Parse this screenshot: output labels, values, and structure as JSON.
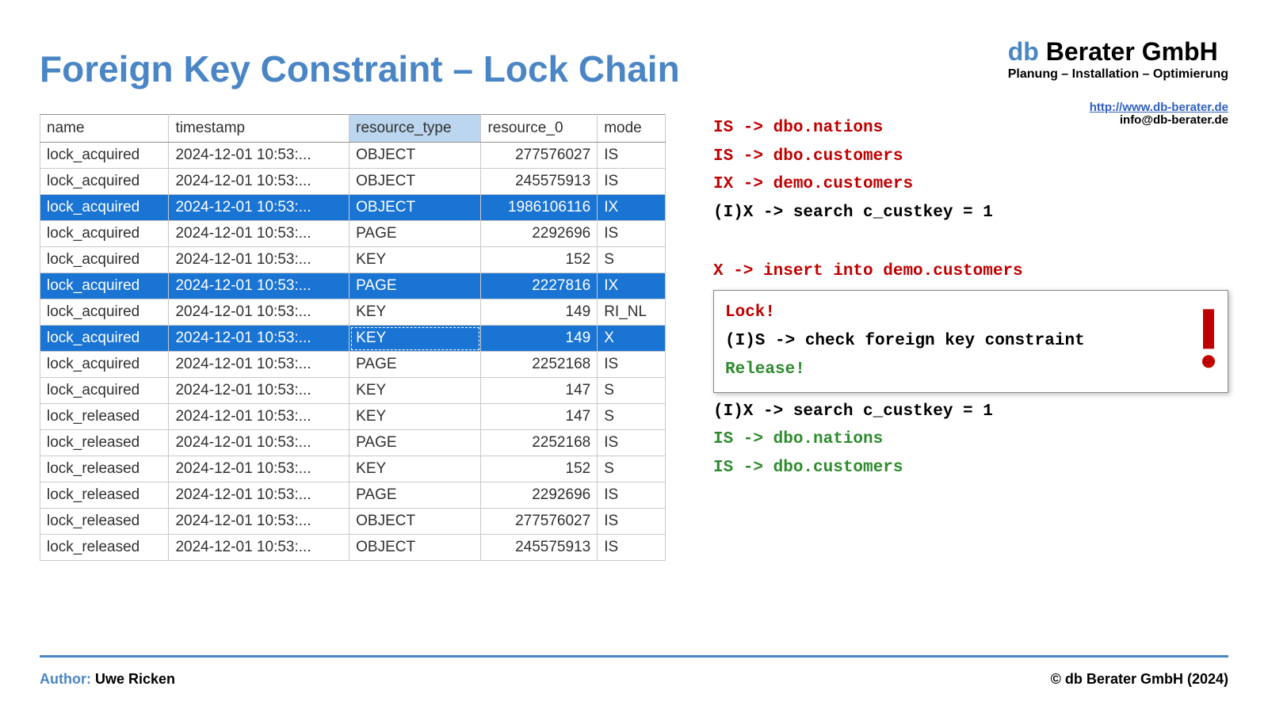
{
  "title": "Foreign Key Constraint – Lock Chain",
  "branding": {
    "main_prefix": "db",
    "main_rest": " Berater GmbH",
    "tagline": "Planung – Installation – Optimierung",
    "url": "http://www.db-berater.de",
    "email": "info@db-berater.de"
  },
  "table": {
    "headers": {
      "name": "name",
      "timestamp": "timestamp",
      "resource_type": "resource_type",
      "resource_0": "resource_0",
      "mode": "mode"
    },
    "rows": [
      {
        "name": "lock_acquired",
        "timestamp": "2024-12-01 10:53:...",
        "resource_type": "OBJECT",
        "resource_0": "277576027",
        "mode": "IS",
        "selected": false
      },
      {
        "name": "lock_acquired",
        "timestamp": "2024-12-01 10:53:...",
        "resource_type": "OBJECT",
        "resource_0": "245575913",
        "mode": "IS",
        "selected": false
      },
      {
        "name": "lock_acquired",
        "timestamp": "2024-12-01 10:53:...",
        "resource_type": "OBJECT",
        "resource_0": "1986106116",
        "mode": "IX",
        "selected": true
      },
      {
        "name": "lock_acquired",
        "timestamp": "2024-12-01 10:53:...",
        "resource_type": "PAGE",
        "resource_0": "2292696",
        "mode": "IS",
        "selected": false
      },
      {
        "name": "lock_acquired",
        "timestamp": "2024-12-01 10:53:...",
        "resource_type": "KEY",
        "resource_0": "152",
        "mode": "S",
        "selected": false
      },
      {
        "name": "lock_acquired",
        "timestamp": "2024-12-01 10:53:...",
        "resource_type": "PAGE",
        "resource_0": "2227816",
        "mode": "IX",
        "selected": true
      },
      {
        "name": "lock_acquired",
        "timestamp": "2024-12-01 10:53:...",
        "resource_type": "KEY",
        "resource_0": "149",
        "mode": "RI_NL",
        "selected": false
      },
      {
        "name": "lock_acquired",
        "timestamp": "2024-12-01 10:53:...",
        "resource_type": "KEY",
        "resource_0": "149",
        "mode": "X",
        "selected": true,
        "focus": true
      },
      {
        "name": "lock_acquired",
        "timestamp": "2024-12-01 10:53:...",
        "resource_type": "PAGE",
        "resource_0": "2252168",
        "mode": "IS",
        "selected": false
      },
      {
        "name": "lock_acquired",
        "timestamp": "2024-12-01 10:53:...",
        "resource_type": "KEY",
        "resource_0": "147",
        "mode": "S",
        "selected": false
      },
      {
        "name": "lock_released",
        "timestamp": "2024-12-01 10:53:...",
        "resource_type": "KEY",
        "resource_0": "147",
        "mode": "S",
        "selected": false
      },
      {
        "name": "lock_released",
        "timestamp": "2024-12-01 10:53:...",
        "resource_type": "PAGE",
        "resource_0": "2252168",
        "mode": "IS",
        "selected": false
      },
      {
        "name": "lock_released",
        "timestamp": "2024-12-01 10:53:...",
        "resource_type": "KEY",
        "resource_0": "152",
        "mode": "S",
        "selected": false
      },
      {
        "name": "lock_released",
        "timestamp": "2024-12-01 10:53:...",
        "resource_type": "PAGE",
        "resource_0": "2292696",
        "mode": "IS",
        "selected": false
      },
      {
        "name": "lock_released",
        "timestamp": "2024-12-01 10:53:...",
        "resource_type": "OBJECT",
        "resource_0": "277576027",
        "mode": "IS",
        "selected": false
      },
      {
        "name": "lock_released",
        "timestamp": "2024-12-01 10:53:...",
        "resource_type": "OBJECT",
        "resource_0": "245575913",
        "mode": "IS",
        "selected": false
      }
    ]
  },
  "explain": {
    "lines_top": [
      {
        "text": "IS -> dbo.nations",
        "cls": "red"
      },
      {
        "text": "IS -> dbo.customers",
        "cls": "red"
      },
      {
        "text": "IX -> demo.customers",
        "cls": "red"
      },
      {
        "text": "(I)X -> search c_custkey = 1",
        "cls": "black"
      }
    ],
    "line_x": "X -> insert into demo.customers",
    "box": {
      "lock": "Lock!",
      "check": "(I)S -> check foreign key constraint",
      "release": "Release!"
    },
    "lines_bottom": [
      {
        "text": "(I)X -> search c_custkey = 1",
        "cls": "black"
      },
      {
        "text": "IS -> dbo.nations",
        "cls": "green"
      },
      {
        "text": "IS -> dbo.customers",
        "cls": "green"
      }
    ]
  },
  "footer": {
    "author_label": "Author:",
    "author_name": "Uwe Ricken",
    "copyright": "© db Berater GmbH (2024)"
  }
}
